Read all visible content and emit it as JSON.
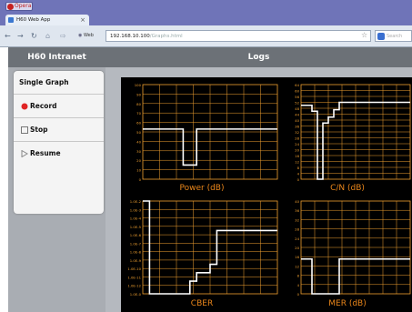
{
  "browser": {
    "menu_label": "Opera",
    "tab_title": "H60 Web App",
    "tab_close": "×",
    "new_tab": "+",
    "web_label": "Web",
    "url_host": "192.168.10.100",
    "url_path": "/Graphs.html",
    "search_placeholder": "Search"
  },
  "sidebar": {
    "title": "H60 Intranet",
    "items": [
      {
        "label": "Single Graph"
      },
      {
        "label": "Record",
        "icon": "record-icon"
      },
      {
        "label": "Stop",
        "icon": "stop-icon"
      },
      {
        "label": "Resume",
        "icon": "play-icon"
      }
    ]
  },
  "main": {
    "title": "Logs"
  },
  "colors": {
    "trace": "#ffffff",
    "grid": "#f0a030",
    "label": "#e8851a",
    "panel": "#000000"
  },
  "chart_data": [
    {
      "type": "line",
      "title": "Power (dB)",
      "yticks": [
        "100",
        "90",
        "80",
        "70",
        "60",
        "50",
        "40",
        "30",
        "20",
        "10",
        "0"
      ],
      "ylim": [
        0,
        100
      ],
      "x": [
        0,
        1,
        2,
        3,
        4,
        5,
        6,
        7,
        8,
        9,
        10,
        11,
        12,
        13,
        14,
        15,
        16,
        17,
        18,
        19,
        20
      ],
      "values": [
        53,
        53,
        53,
        53,
        53,
        53,
        15,
        15,
        53,
        53,
        53,
        53,
        53,
        53,
        53,
        53,
        53,
        53,
        53,
        53,
        53
      ],
      "grid": true
    },
    {
      "type": "line",
      "title": "C/N (dB)",
      "yticks": [
        "64",
        "60",
        "56",
        "52",
        "48",
        "44",
        "40",
        "36",
        "32",
        "28",
        "24",
        "20",
        "16",
        "12",
        "8",
        "4",
        "0"
      ],
      "ylim": [
        0,
        64
      ],
      "x": [
        0,
        1,
        2,
        3,
        4,
        5,
        6,
        7,
        8,
        9,
        10,
        11,
        12,
        13,
        14,
        15,
        16,
        17,
        18,
        19,
        20
      ],
      "values": [
        50,
        50,
        46,
        0,
        38,
        42,
        47,
        52,
        52,
        52,
        52,
        52,
        52,
        52,
        52,
        52,
        52,
        52,
        52,
        52,
        52
      ],
      "grid": true
    },
    {
      "type": "line",
      "title": "CBER",
      "yticks": [
        "1.0E-2",
        "1.0E-3",
        "1.0E-4",
        "1.0E-5",
        "1.0E-6",
        "1.0E-7",
        "1.0E-8",
        "1.0E-9",
        "1.0E-10",
        "1.0E-11",
        "1.0E-12",
        "1.0E-0"
      ],
      "ylim": [
        0,
        11
      ],
      "x": [
        0,
        1,
        2,
        3,
        4,
        5,
        6,
        7,
        8,
        9,
        10,
        11,
        12,
        13,
        14,
        15,
        16,
        17,
        18,
        19,
        20
      ],
      "values": [
        11,
        0,
        0,
        0,
        0,
        0,
        0,
        1.5,
        2.5,
        2.5,
        3.5,
        7.5,
        7.5,
        7.5,
        7.5,
        7.5,
        7.5,
        7.5,
        7.5,
        7.5,
        7.5
      ],
      "grid": true
    },
    {
      "type": "line",
      "title": "MER (dB)",
      "yticks": [
        "40",
        "36",
        "32",
        "28",
        "24",
        "20",
        "16",
        "12",
        "8",
        "4",
        "0"
      ],
      "ylim": [
        0,
        40
      ],
      "x": [
        0,
        1,
        2,
        3,
        4,
        5,
        6,
        7,
        8,
        9,
        10,
        11,
        12,
        13,
        14,
        15,
        16,
        17,
        18,
        19,
        20
      ],
      "values": [
        15,
        15,
        0,
        0,
        0,
        0,
        0,
        15,
        15,
        15,
        15,
        15,
        15,
        15,
        15,
        15,
        15,
        15,
        15,
        15,
        15
      ],
      "grid": true
    }
  ]
}
